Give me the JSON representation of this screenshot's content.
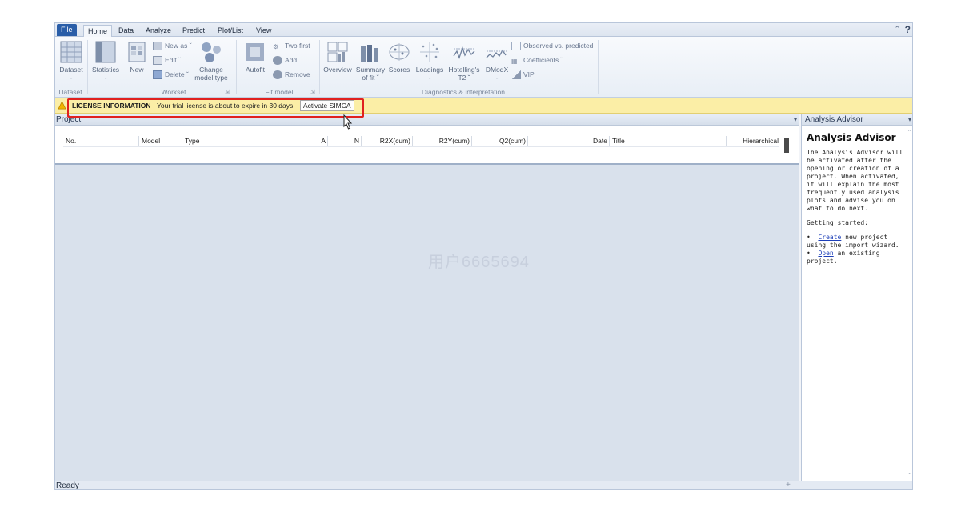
{
  "menu": {
    "tabs": [
      "File",
      "Home",
      "Data",
      "Analyze",
      "Predict",
      "Plot/List",
      "View"
    ],
    "help": "?"
  },
  "ribbon": {
    "dataset": {
      "label": "Dataset",
      "sub": "-",
      "group": "Dataset"
    },
    "statistics": {
      "label": "Statistics",
      "sub": "-"
    },
    "new": {
      "label": "New"
    },
    "new_as": "New as",
    "edit": "Edit",
    "delete": "Delete",
    "change_model_type": [
      "Change",
      "model type"
    ],
    "workset_group": "Workset",
    "autofit": "Autofit",
    "two_first": "Two first",
    "add": "Add",
    "remove": "Remove",
    "fit_model_group": "Fit model",
    "overview": "Overview",
    "summary_of_fit": [
      "Summary",
      "of fit"
    ],
    "scores": "Scores",
    "loadings": "Loadings",
    "hotellings_t2": [
      "Hotelling's",
      "T2"
    ],
    "dmodx": "DModX",
    "observed_vs_predicted": "Observed vs. predicted",
    "coefficients": "Coefficients",
    "vip": "VIP",
    "diagnostics_group": "Diagnostics & interpretation"
  },
  "infobar": {
    "title": "LICENSE INFORMATION",
    "message": "Your trial license is about to expire in 30 days.",
    "button": "Activate SIMCA"
  },
  "project": {
    "title": "Project",
    "columns": [
      "No.",
      "Model",
      "Type",
      "A",
      "N",
      "R2X(cum)",
      "R2Y(cum)",
      "Q2(cum)",
      "Date",
      "Title",
      "Hierarchical"
    ]
  },
  "watermark": "用户6665694",
  "advisor": {
    "panel_title": "Analysis Advisor",
    "heading": "Analysis Advisor",
    "intro": "The Analysis Advisor will be activated after the opening or creation of a project. When activated, it will explain the most frequently used analysis plots and advise you on what to do next.",
    "getting_started": "Getting started:",
    "create_link": "Create",
    "create_rest": " new project using the import wizard.",
    "open_link": "Open",
    "open_rest": " an existing project."
  },
  "status": {
    "text": "Ready"
  },
  "colors": {
    "file_tab": "#2a5ea8",
    "infobar": "#fbeea6",
    "highlight": "#e0211f",
    "link": "#1d3fb8"
  }
}
